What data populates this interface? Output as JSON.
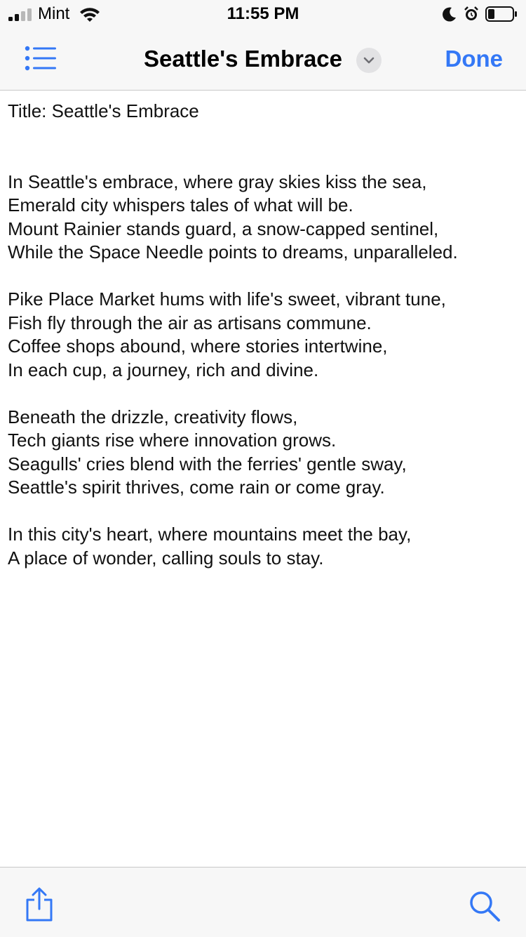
{
  "status_bar": {
    "carrier": "Mint",
    "time": "11:55 PM",
    "icons": [
      "signal-bars-icon",
      "wifi-icon",
      "moon-icon",
      "alarm-clock-icon",
      "battery-icon"
    ]
  },
  "nav": {
    "title": "Seattle's Embrace",
    "done_label": "Done",
    "icons": [
      "list-icon",
      "chevron-down-icon"
    ]
  },
  "document": {
    "lines": [
      "Title: Seattle's Embrace",
      "",
      "",
      "In Seattle's embrace, where gray skies kiss the sea,",
      "Emerald city whispers tales of what will be.",
      "Mount Rainier stands guard, a snow-capped sentinel,",
      "While the Space Needle points to dreams, unparalleled.",
      "",
      "Pike Place Market hums with life's sweet, vibrant tune,",
      "Fish fly through the air as artisans commune.",
      "Coffee shops abound, where stories intertwine,",
      "In each cup, a journey, rich and divine.",
      "",
      "Beneath the drizzle, creativity flows,",
      "Tech giants rise where innovation grows.",
      "Seagulls' cries blend with the ferries' gentle sway,",
      "Seattle's spirit thrives, come rain or come gray.",
      "",
      "In this city's heart, where mountains meet the bay,",
      "A place of wonder, calling souls to stay."
    ]
  },
  "toolbar": {
    "icons": [
      "share-icon",
      "search-icon"
    ]
  },
  "colors": {
    "accent": "#3478f6",
    "bar_background": "#f7f7f7",
    "separator": "#c8c8c8",
    "text": "#111111"
  }
}
